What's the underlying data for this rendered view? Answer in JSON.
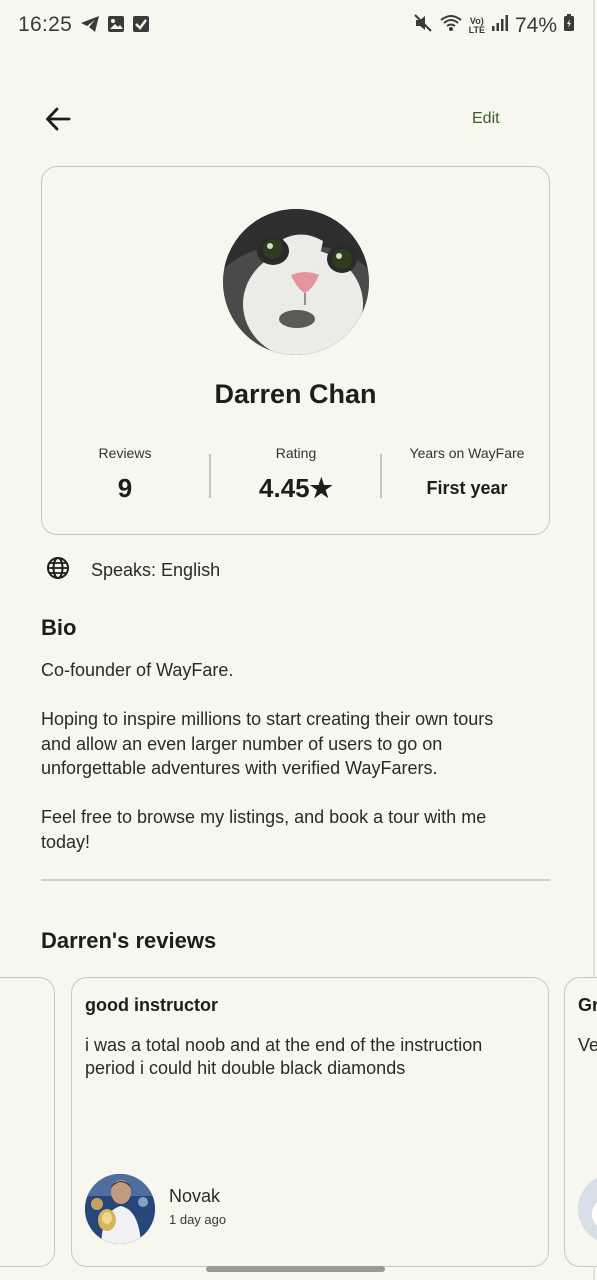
{
  "status_bar": {
    "time": "16:25",
    "battery": "74%",
    "volte_top": "Vo)",
    "volte_bottom": "LTE",
    "icons_left": [
      "telegram-icon",
      "gallery-icon",
      "checkbox-icon"
    ],
    "icons_right": [
      "mute-icon",
      "wifi-icon",
      "volte-icon",
      "signal-icon",
      "battery-icon"
    ]
  },
  "header": {
    "back_icon": "arrow-left-icon",
    "edit_label": "Edit"
  },
  "profile": {
    "name": "Darren Chan",
    "avatar": "cat-photo",
    "stats": {
      "reviews_label": "Reviews",
      "reviews_value": "9",
      "rating_label": "Rating",
      "rating_value": "4.45★",
      "years_label": "Years on WayFare",
      "years_value": "First year"
    }
  },
  "languages": {
    "icon": "globe-icon",
    "text": "Speaks: English"
  },
  "bio": {
    "heading": "Bio",
    "paragraphs": [
      "Co-founder of WayFare.",
      "Hoping to inspire millions to start creating their own tours and allow an even larger number of users to go on unforgettable adventures with verified WayFarers.",
      "Feel free to browse my listings, and book a tour with me today!"
    ]
  },
  "reviews": {
    "heading": "Darren's reviews",
    "items": [
      {
        "title": "good instructor",
        "body": "i was a total noob and at the end of the instruction period i could hit double black diamonds",
        "reviewer": "Novak",
        "time": "1 day ago"
      },
      {
        "title": "Gr",
        "body": "Ve"
      }
    ]
  },
  "colors": {
    "background": "#f7f7f0",
    "accent": "#3c5c2e",
    "border": "#c9c9c2",
    "text": "#1d1d1b"
  }
}
